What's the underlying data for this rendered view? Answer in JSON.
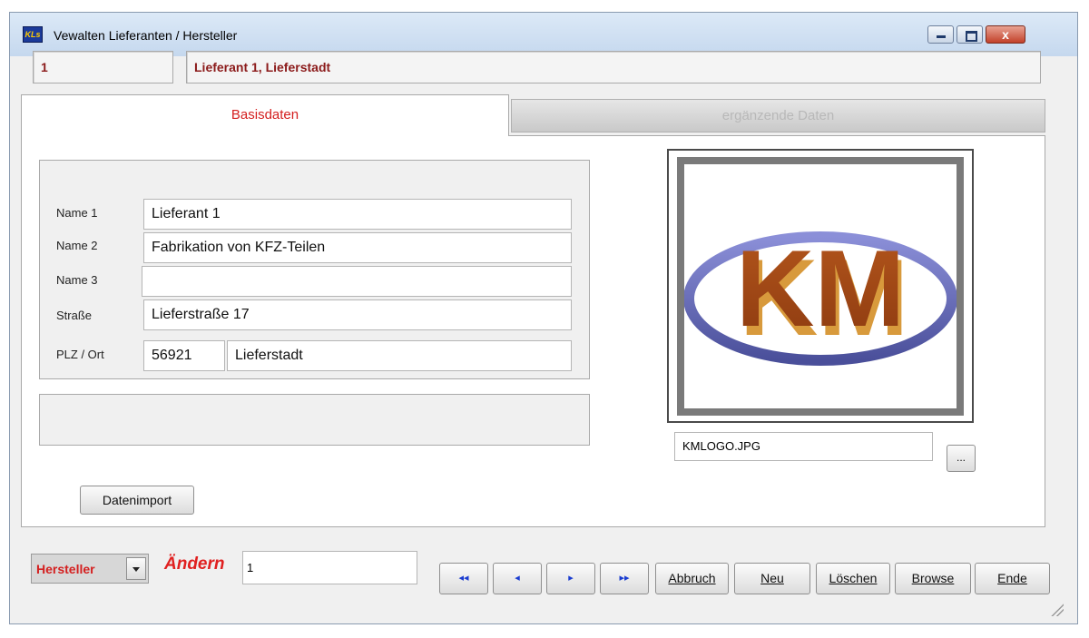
{
  "window": {
    "title": "Vewalten Lieferanten / Hersteller",
    "icon_text": "KLs",
    "close_glyph": "x"
  },
  "header": {
    "id": "1",
    "name": "Lieferant 1, Lieferstadt"
  },
  "tabs": {
    "active": "Basisdaten",
    "inactive": "ergänzende Daten"
  },
  "form": {
    "name1_label": "Name 1",
    "name1_value": "Lieferant 1",
    "name2_label": "Name 2",
    "name2_value": "Fabrikation von KFZ-Teilen",
    "name3_label": "Name 3",
    "name3_value": "",
    "street_label": "Straße",
    "street_value": "Lieferstraße 17",
    "plzort_label": "PLZ  / Ort",
    "plz_value": "56921",
    "ort_value": "Lieferstadt"
  },
  "buttons": {
    "import": "Datenimport",
    "browse_file": "...",
    "abbruch": "Abbruch",
    "neu": "Neu",
    "loeschen": "Löschen",
    "browse": "Browse",
    "ende": "Ende"
  },
  "logo": {
    "text": "KM",
    "file": "KMLOGO.JPG"
  },
  "footer": {
    "filter": "Hersteller",
    "mode": "Ändern",
    "record": "1"
  },
  "nav": {
    "first": "◂◂",
    "prev": "◂",
    "next": "▸",
    "last": "▸▸"
  },
  "colors": {
    "accent_red": "#d42020",
    "header_red": "#8b1a1a",
    "nav_blue": "#1a3cd0"
  }
}
